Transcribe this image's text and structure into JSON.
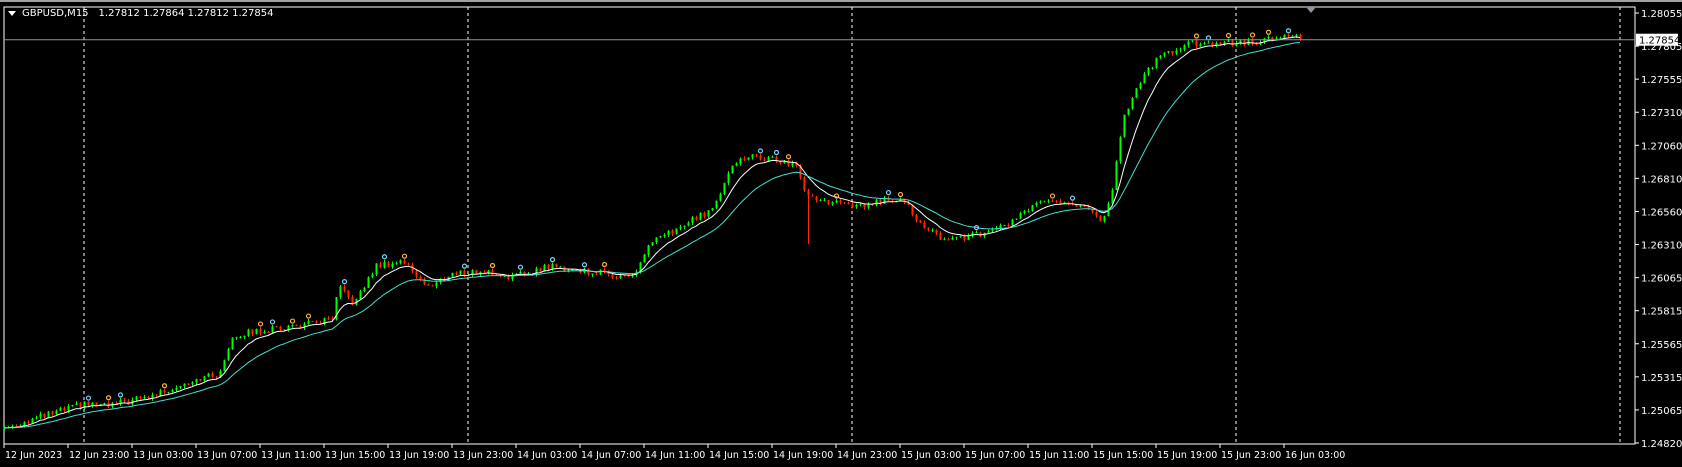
{
  "header": {
    "symbol": "GBPUSD,M15",
    "ohlc": "1.27812 1.27864 1.27812 1.27854"
  },
  "colors": {
    "background": "#000000",
    "bull": "#00ff00",
    "bear": "#ff2a00",
    "axis": "#ffffff",
    "ma_fast": "#ffffff",
    "ma_slow": "#40e0d0",
    "marker_a": "#7fd4ff",
    "marker_b": "#ffb347",
    "price_line": "#8a95a5"
  },
  "chart_data": {
    "type": "candlestick",
    "symbol": "GBPUSD",
    "timeframe": "M15",
    "current_price": 1.27854,
    "current_price_label": "1.27854",
    "ylim": [
      1.2482,
      1.28055
    ],
    "y_tick_labels": [
      "1.28055",
      "1.27805",
      "1.27555",
      "1.27310",
      "1.27060",
      "1.26810",
      "1.26560",
      "1.26310",
      "1.26065",
      "1.25815",
      "1.25565",
      "1.25315",
      "1.25065",
      "1.24820"
    ],
    "x_tick_labels": [
      "12 Jun 2023",
      "12 Jun 23:00",
      "13 Jun 03:00",
      "13 Jun 07:00",
      "13 Jun 11:00",
      "13 Jun 15:00",
      "13 Jun 19:00",
      "13 Jun 23:00",
      "14 Jun 03:00",
      "14 Jun 07:00",
      "14 Jun 11:00",
      "14 Jun 15:00",
      "14 Jun 19:00",
      "14 Jun 23:00",
      "15 Jun 03:00",
      "15 Jun 07:00",
      "15 Jun 11:00",
      "15 Jun 15:00",
      "15 Jun 19:00",
      "15 Jun 23:00",
      "16 Jun 03:00"
    ],
    "x_tick_hours": [
      0,
      4,
      8,
      12,
      16,
      20,
      24,
      28,
      32,
      36,
      40,
      44,
      48,
      52,
      56,
      60,
      64,
      68,
      72,
      76,
      80
    ],
    "day_separator_hours": [
      5,
      29,
      53,
      77,
      101
    ],
    "bar_minutes": 15,
    "price_path": {
      "hours": [
        0,
        3.8,
        5.1,
        6.4,
        9.1,
        11.8,
        13.5,
        14.2,
        15.8,
        18.5,
        20.5,
        20.9,
        21.9,
        23.2,
        24.9,
        26.6,
        27.9,
        29.9,
        31.9,
        34,
        36.6,
        39.3,
        40.3,
        42.7,
        44.4,
        45.4,
        46.7,
        49.4,
        50.2,
        51.4,
        53.4,
        56.1,
        57.4,
        58.8,
        61.5,
        62.8,
        64.8,
        66.8,
        67.9,
        68.5,
        69.2,
        69.9,
        70.9,
        72.2,
        74.2,
        76.9,
        78.9,
        80.3,
        81.1
      ],
      "close": [
        1.24933,
        1.25071,
        1.25112,
        1.25096,
        1.25169,
        1.25298,
        1.25339,
        1.25623,
        1.25663,
        1.25704,
        1.25744,
        1.25987,
        1.25866,
        1.2615,
        1.2619,
        1.25987,
        1.26093,
        1.26109,
        1.26069,
        1.2615,
        1.26109,
        1.26069,
        1.26312,
        1.26474,
        1.26596,
        1.2692,
        1.26977,
        1.2692,
        1.26677,
        1.26636,
        1.26596,
        1.26677,
        1.26433,
        1.26352,
        1.26393,
        1.26474,
        1.26636,
        1.26636,
        1.26555,
        1.26474,
        1.26677,
        1.27244,
        1.27528,
        1.27731,
        1.27828,
        1.27828,
        1.27852,
        1.27893,
        1.27854
      ]
    },
    "indicators": [
      "moving average (fast)",
      "moving average (slow)",
      "swing markers"
    ]
  }
}
